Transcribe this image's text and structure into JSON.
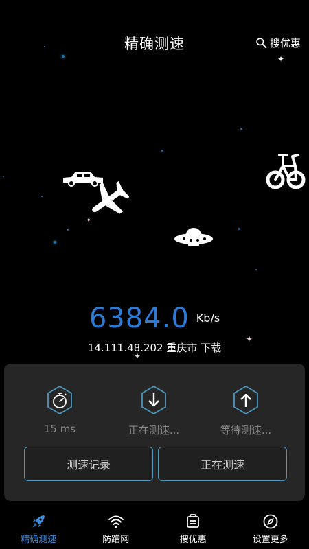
{
  "header": {
    "title": "精确测速",
    "search_label": "搜优惠"
  },
  "speed": {
    "value": "6384.0",
    "unit": "Kb/s",
    "ip_location": "14.111.48.202 重庆市  下载"
  },
  "stats": [
    {
      "icon": "stopwatch-icon",
      "label": "15 ms"
    },
    {
      "icon": "download-arrow-icon",
      "label": "正在测速..."
    },
    {
      "icon": "upload-arrow-icon",
      "label": "等待测速..."
    }
  ],
  "buttons": {
    "history": "测速记录",
    "testing": "正在测速"
  },
  "tabs": [
    {
      "icon": "rocket-icon",
      "label": "精确测速",
      "active": true
    },
    {
      "icon": "wifi-icon",
      "label": "防蹭网",
      "active": false
    },
    {
      "icon": "coupon-icon",
      "label": "搜优惠",
      "active": false
    },
    {
      "icon": "compass-icon",
      "label": "设置更多",
      "active": false
    }
  ],
  "colors": {
    "accent": "#2d7bd6",
    "button_border": "#4e96be",
    "panel": "#262626",
    "background": "#000000"
  }
}
